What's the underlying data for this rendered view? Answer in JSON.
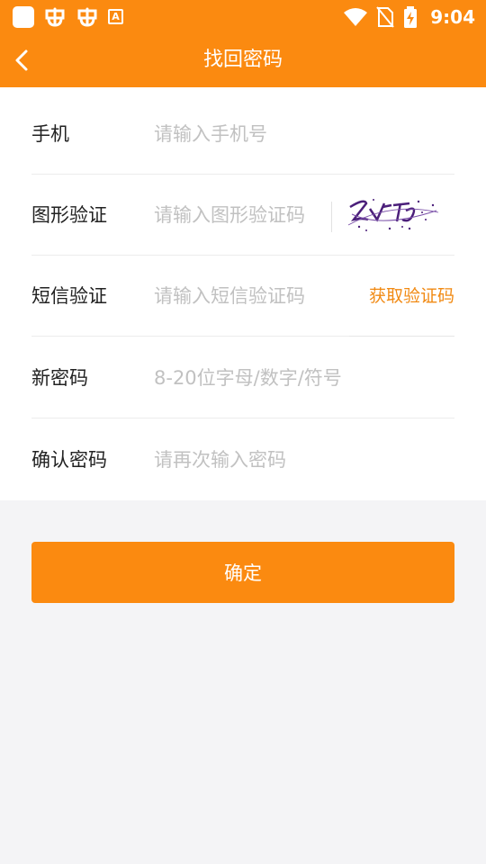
{
  "status_bar": {
    "time": "9:04",
    "left_icons": [
      "app-icon",
      "bug-icon",
      "bug-icon",
      "accessibility-icon"
    ],
    "right_icons": [
      "wifi-icon",
      "no-sim-icon",
      "battery-charging-icon"
    ],
    "small_icon_text": "A"
  },
  "header": {
    "title": "找回密码",
    "back_icon": "chevron-left-icon"
  },
  "form": {
    "phone": {
      "label": "手机",
      "placeholder": "请输入手机号"
    },
    "captcha": {
      "label": "图形验证",
      "placeholder": "请输入图形验证码"
    },
    "sms": {
      "label": "短信验证",
      "placeholder": "请输入短信验证码",
      "button": "获取验证码"
    },
    "new_password": {
      "label": "新密码",
      "placeholder": "8-20位字母/数字/符号"
    },
    "confirm_password": {
      "label": "确认密码",
      "placeholder": "请再次输入密码"
    }
  },
  "submit": {
    "label": "确定"
  },
  "colors": {
    "accent": "#fb8a10",
    "link": "#f18a13",
    "background": "#f4f4f6",
    "placeholder": "#c1c1c1"
  }
}
